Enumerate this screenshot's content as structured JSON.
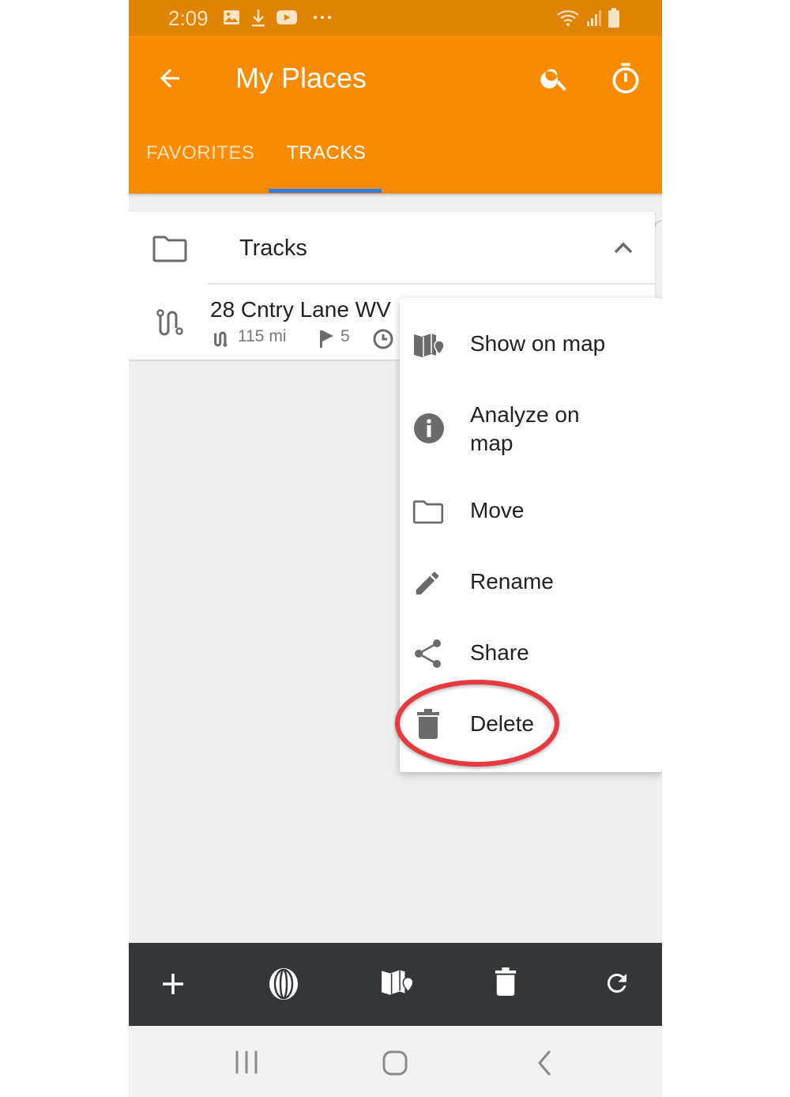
{
  "status_bar": {
    "time": "2:09",
    "left_icons": [
      "image-icon",
      "download-icon",
      "youtube-icon",
      "more-dots-icon"
    ],
    "right_icons": [
      "wifi-icon",
      "signal-icon",
      "battery-icon"
    ]
  },
  "app_bar": {
    "title": "My Places",
    "back_icon": "arrow-left-icon",
    "actions": [
      "search-icon",
      "stopwatch-icon"
    ]
  },
  "tabs": [
    {
      "label": "FAVORITES",
      "active": false
    },
    {
      "label": "TRACKS",
      "active": true
    }
  ],
  "folder": {
    "label": "Tracks",
    "icon": "folder-icon",
    "expanded": true
  },
  "track": {
    "name": "28 Cntry Lane WV",
    "distance": "115 mi",
    "waypoints": "5"
  },
  "context_menu": {
    "items": [
      {
        "label": "Show on map",
        "icon": "map-pin-icon"
      },
      {
        "label": "Analyze on map",
        "icon": "info-icon"
      },
      {
        "label": "Move",
        "icon": "folder-icon"
      },
      {
        "label": "Rename",
        "icon": "pencil-icon"
      },
      {
        "label": "Share",
        "icon": "share-icon"
      },
      {
        "label": "Delete",
        "icon": "trash-icon",
        "highlighted": true
      }
    ]
  },
  "bottom_toolbar": {
    "buttons": [
      "plus-icon",
      "globe-icon",
      "map-pin-icon",
      "trash-icon",
      "refresh-icon"
    ]
  },
  "system_nav": [
    "recents-icon",
    "home-icon",
    "back-icon"
  ],
  "colors": {
    "status_bar": "#e08300",
    "app_bar": "#f98b00",
    "tab_indicator": "#2f7bf0",
    "bottom_toolbar": "#343739",
    "highlight_ring": "#e53a3f",
    "icon_gray": "#6b6b6b"
  }
}
